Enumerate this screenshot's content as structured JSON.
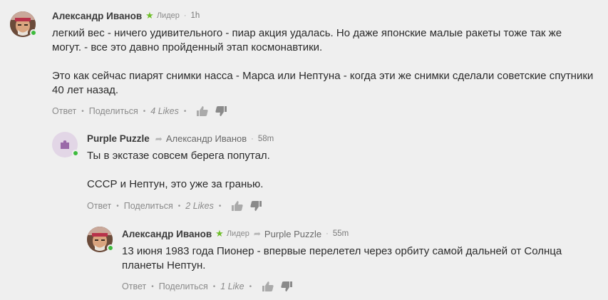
{
  "comments": [
    {
      "author": "Александр Иванов",
      "badge": "Лидер",
      "time": "1h",
      "paragraphs": [
        "легкий вес - ничего удивительного - пиар акция удалась. Но даже японские малые ракеты тоже так же могут. - все это давно пройденный этап космонавтики.",
        "Это как сейчас пиарят снимки насса - Марса или Нептуна -  когда эти же снимки сделали советские спутники 40 лет назад."
      ],
      "actions": {
        "reply": "Ответ",
        "share": "Поделиться",
        "likes": "4 Likes"
      }
    },
    {
      "author": "Purple Puzzle",
      "reply_to": "Александр Иванов",
      "time": "58m",
      "paragraphs": [
        "Ты в экстазе совсем берега попутал.",
        "СССР и Нептун, это уже за гранью."
      ],
      "actions": {
        "reply": "Ответ",
        "share": "Поделиться",
        "likes": "2 Likes"
      }
    },
    {
      "author": "Александр Иванов",
      "badge": "Лидер",
      "reply_to": "Purple Puzzle",
      "time": "55m",
      "paragraphs": [
        "13 июня 1983 года Пионер - впервые перелетел через орбиту самой дальней от Солнца планеты Нептун."
      ],
      "actions": {
        "reply": "Ответ",
        "share": "Поделиться",
        "likes": "1 Like"
      }
    }
  ],
  "colors": {
    "background": "#efefef",
    "online": "#3dbb3d",
    "leader_star": "#6fbf2a",
    "puzzle_avatar_bg": "#e2d6e6",
    "puzzle_icon": "#9a6aa8"
  },
  "icons": [
    "star-icon",
    "reply-arrow-icon",
    "thumbs-up-icon",
    "thumbs-down-icon",
    "puzzle-icon"
  ]
}
